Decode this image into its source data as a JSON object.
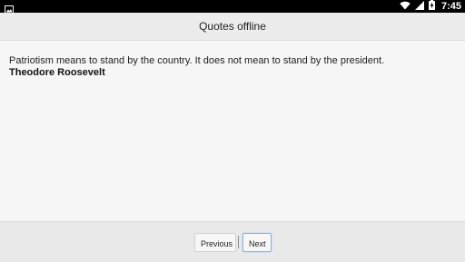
{
  "status_bar": {
    "time": "7:45",
    "left_icon": "image-icon",
    "icons": [
      "wifi-icon",
      "signal-icon",
      "battery-charging-icon"
    ]
  },
  "header": {
    "title": "Quotes offline"
  },
  "quote": {
    "text": "Patriotism means to stand by the country. It does not mean to stand by the president.",
    "author": "Theodore Roosevelt"
  },
  "navigation": {
    "previous_label": "Previous",
    "next_label": "Next",
    "separator": "|"
  }
}
